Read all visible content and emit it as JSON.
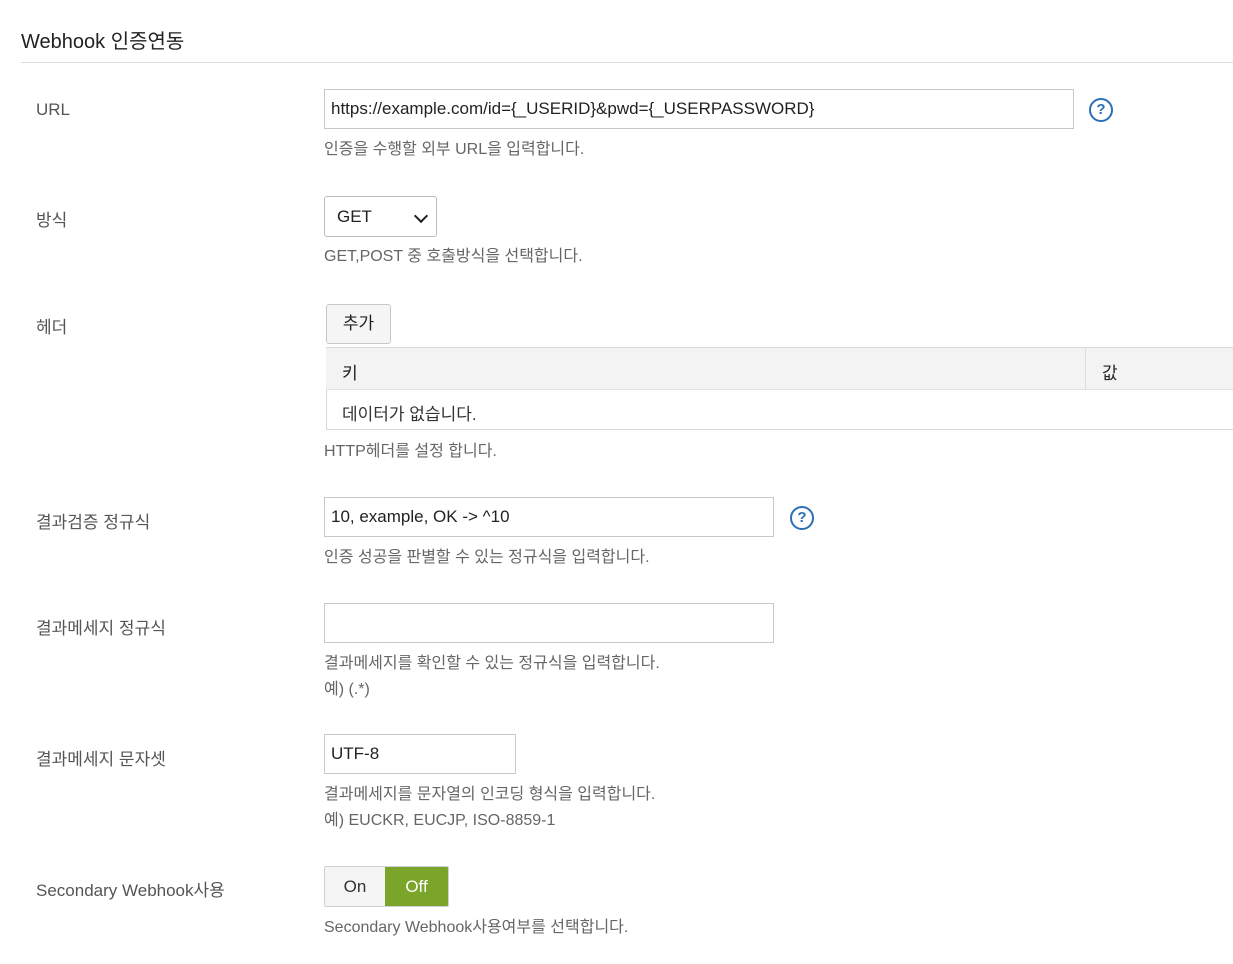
{
  "section": {
    "title": "Webhook 인증연동"
  },
  "url": {
    "label": "URL",
    "value": "https://example.com/id={_USERID}&pwd={_USERPASSWORD}",
    "help": "인증을 수행할 외부 URL을 입력합니다.",
    "help_icon": "question-circle-icon"
  },
  "method": {
    "label": "방식",
    "selected": "GET",
    "help": "GET,POST 중 호출방식을 선택합니다."
  },
  "header": {
    "label": "헤더",
    "add_label": "추가",
    "columns": [
      "키",
      "값"
    ],
    "empty_text": "데이터가 없습니다.",
    "help": "HTTP헤더를 설정 합니다."
  },
  "result_regex": {
    "label": "결과검증 정규식",
    "value": "10, example, OK -> ^10",
    "help": "인증 성공을 판별할 수 있는 정규식을 입력합니다.",
    "help_icon": "question-circle-icon"
  },
  "result_msg_regex": {
    "label": "결과메세지 정규식",
    "value": "",
    "help_line1": "결과메세지를 확인할 수 있는 정규식을 입력합니다.",
    "help_line2": "예) (.*)"
  },
  "result_msg_charset": {
    "label": "결과메세지 문자셋",
    "value": "UTF-8",
    "help_line1": "결과메세지를 문자열의 인코딩 형식을 입력합니다.",
    "help_line2": "예) EUCKR, EUCJP, ISO-8859-1"
  },
  "secondary": {
    "label": "Secondary Webhook사용",
    "on_label": "On",
    "off_label": "Off",
    "selected": "Off",
    "active_color": "#7aa52a",
    "help": "Secondary Webhook사용여부를 선택합니다."
  }
}
